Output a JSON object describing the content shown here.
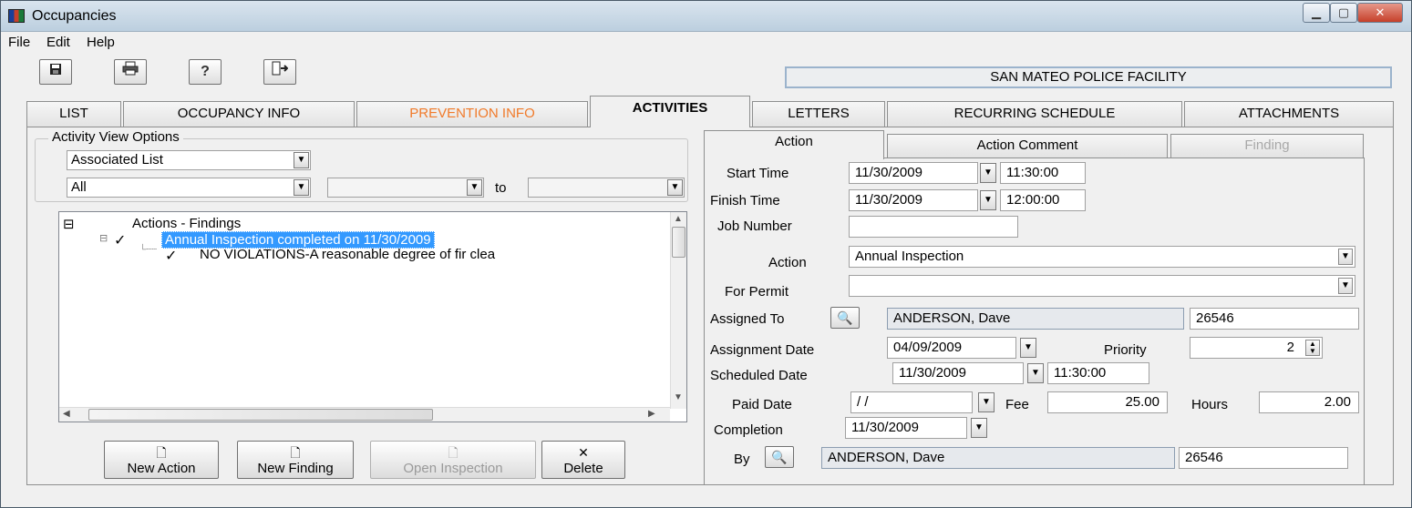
{
  "window": {
    "title": "Occupancies"
  },
  "menu": {
    "items": [
      {
        "label": "File"
      },
      {
        "label": "Edit"
      },
      {
        "label": "Help"
      }
    ]
  },
  "toolbar": {
    "icons": [
      "save-icon",
      "print-icon",
      "help-icon",
      "exit-icon"
    ]
  },
  "facility": {
    "name": "SAN MATEO POLICE FACILITY"
  },
  "tabs": [
    {
      "label": "LIST"
    },
    {
      "label": "OCCUPANCY INFO"
    },
    {
      "label": "PREVENTION INFO"
    },
    {
      "label": "ACTIVITIES"
    },
    {
      "label": "LETTERS"
    },
    {
      "label": "RECURRING SCHEDULE"
    },
    {
      "label": "ATTACHMENTS"
    }
  ],
  "activity_view": {
    "group_label": "Activity View Options",
    "view_select": "Associated List",
    "filter_select": "All",
    "range_from": "",
    "range_to_label": "to",
    "range_to": ""
  },
  "tree": {
    "root": "Actions - Findings",
    "action": "Annual Inspection completed on 11/30/2009",
    "finding": "NO VIOLATIONS-A reasonable degree of fir clea"
  },
  "buttons": {
    "new_action": "New Action",
    "new_finding": "New Finding",
    "open_inspection": "Open Inspection",
    "delete": "Delete"
  },
  "detail_tabs": [
    {
      "label": "Action"
    },
    {
      "label": "Action Comment"
    },
    {
      "label": "Finding"
    }
  ],
  "detail": {
    "start_time_label": "Start Time",
    "start_date": "11/30/2009",
    "start_time": "11:30:00",
    "finish_time_label": "Finish Time",
    "finish_date": "11/30/2009",
    "finish_time": "12:00:00",
    "job_number_label": "Job Number",
    "job_number": "",
    "action_label": "Action",
    "action_value": "Annual Inspection",
    "for_permit_label": "For Permit",
    "for_permit_value": "",
    "assigned_to_label": "Assigned To",
    "assigned_to_name": "ANDERSON, Dave",
    "assigned_to_id": "26546",
    "assignment_date_label": "Assignment Date",
    "assignment_date": "04/09/2009",
    "priority_label": "Priority",
    "priority": "2",
    "scheduled_date_label": "Scheduled Date",
    "scheduled_date": "11/30/2009",
    "scheduled_time": "11:30:00",
    "paid_date_label": "Paid Date",
    "paid_date": " / /",
    "fee_label": "Fee",
    "fee": "25.00",
    "hours_label": "Hours",
    "hours": "2.00",
    "completion_label": "Completion",
    "completion_date": "11/30/2009",
    "by_label": "By",
    "by_name": "ANDERSON, Dave",
    "by_id": "26546"
  }
}
